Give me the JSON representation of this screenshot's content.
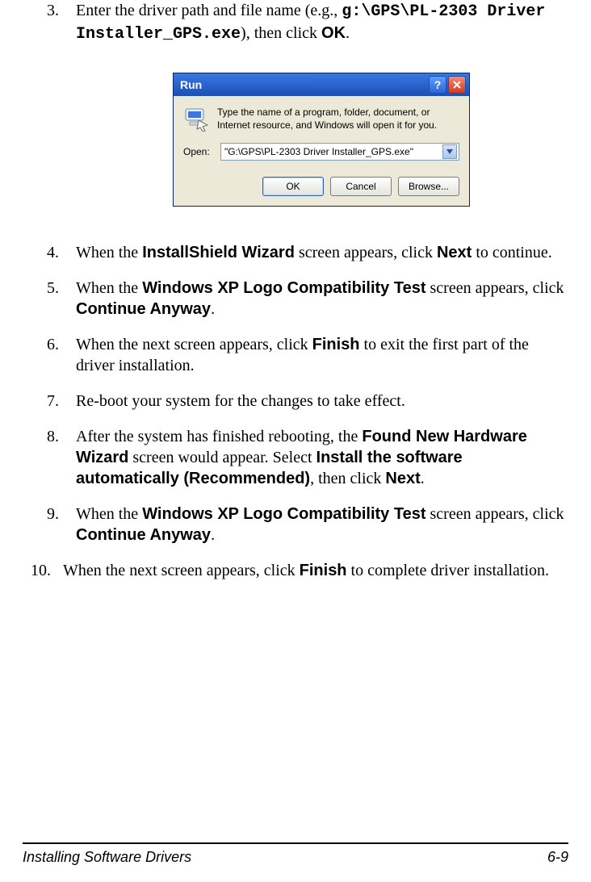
{
  "steps": {
    "s3": {
      "num": "3.",
      "pre": "Enter the driver path and file name (e.g., ",
      "code": "g:\\GPS\\PL-2303 Driver Installer_GPS.exe",
      "mid": "), then click ",
      "bold": "OK",
      "post": "."
    },
    "s4": {
      "num": "4.",
      "a": "When the ",
      "b": "InstallShield Wizard",
      "c": " screen appears, click ",
      "d": "Next",
      "e": " to continue."
    },
    "s5": {
      "num": "5.",
      "a": "When the ",
      "b": "Windows XP Logo Compatibility Test",
      "c": " screen appears, click ",
      "d": "Continue Anyway",
      "e": "."
    },
    "s6": {
      "num": "6.",
      "a": "When the next screen appears, click ",
      "b": "Finish",
      "c": " to exit the first part of the driver installation."
    },
    "s7": {
      "num": "7.",
      "a": "Re-boot your system for the changes to take effect."
    },
    "s8": {
      "num": "8.",
      "a": "After the system has finished rebooting, the ",
      "b": "Found New Hardware Wizard",
      "c": " screen would appear. Select ",
      "d": "Install the software automatically (Recommended)",
      "e": ", then click ",
      "f": "Next",
      "g": "."
    },
    "s9": {
      "num": "9.",
      "a": "When the ",
      "b": "Windows XP Logo Compatibility Test",
      "c": " screen appears, click ",
      "d": "Continue Anyway",
      "e": "."
    },
    "s10": {
      "num": "10.",
      "a": "When the next screen appears, click ",
      "b": "Finish",
      "c": " to complete driver installation."
    }
  },
  "dialog": {
    "title": "Run",
    "help": "?",
    "close": "X",
    "prompt": "Type the name of a program, folder, document, or Internet resource, and Windows will open it for you.",
    "open_label": "Open:",
    "open_value": "\"G:\\GPS\\PL-2303 Driver Installer_GPS.exe\"",
    "ok": "OK",
    "cancel": "Cancel",
    "browse": "Browse..."
  },
  "footer": {
    "left": "Installing Software Drivers",
    "right": "6-9"
  }
}
